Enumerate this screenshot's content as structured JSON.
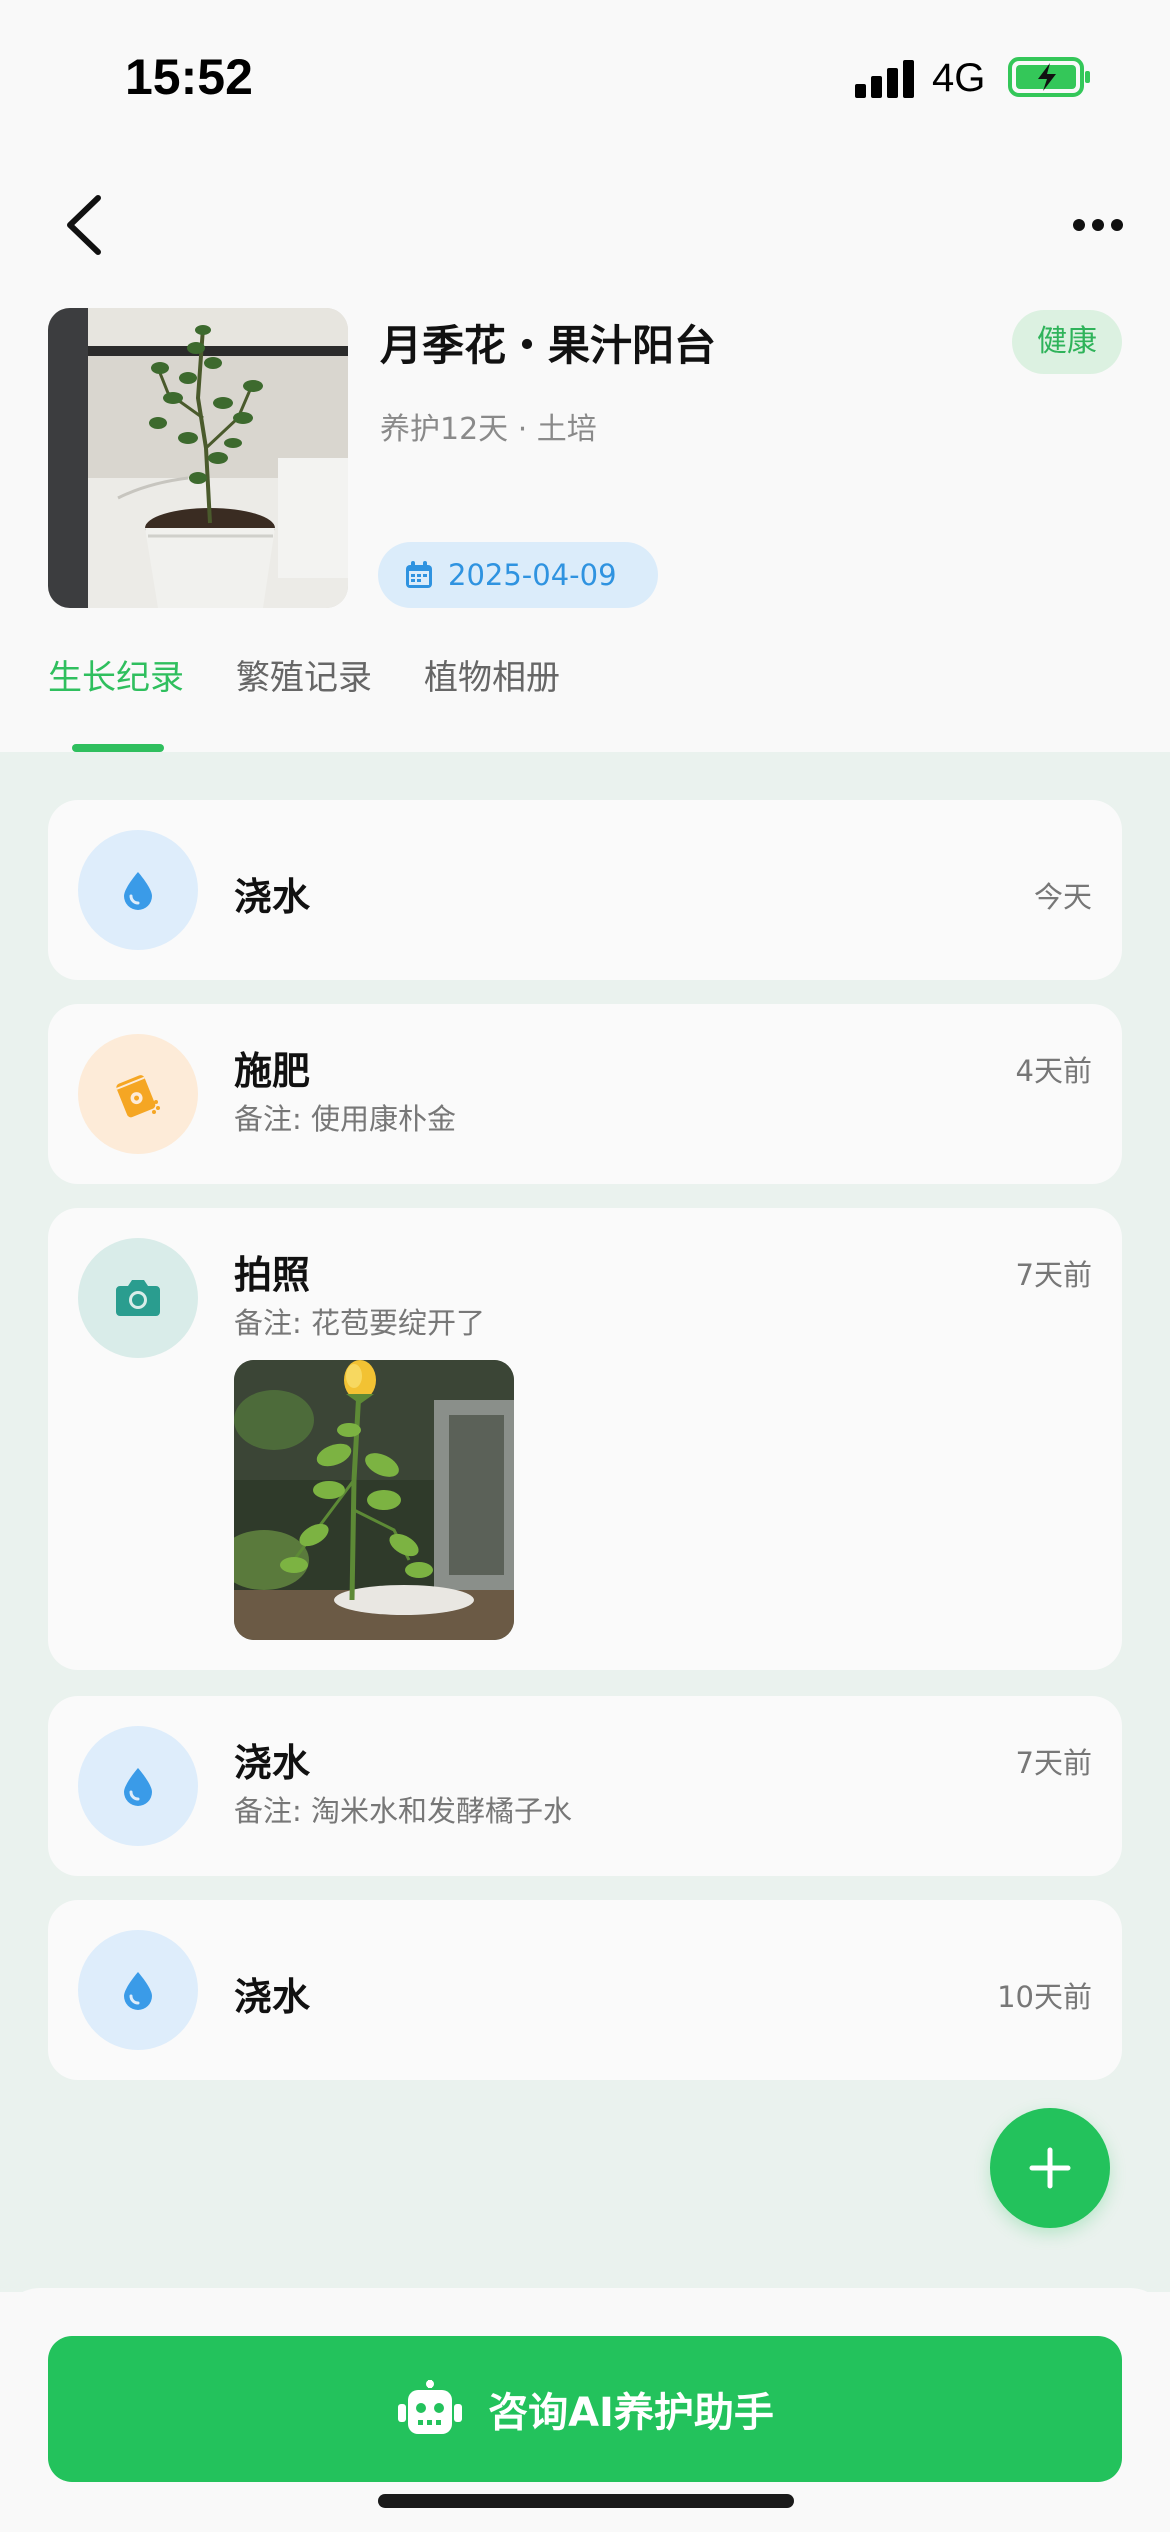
{
  "status_bar": {
    "time": "15:52",
    "network": "4G",
    "battery_color": "#34c759"
  },
  "header": {
    "back_icon": "chevron-left-icon",
    "more_icon": "more-horizontal-icon"
  },
  "plant": {
    "title": "月季花・果汁阳台",
    "health": "健康",
    "meta": "养护12天 · 土培",
    "date": "2025-04-09",
    "date_icon": "calendar-icon"
  },
  "tabs": [
    {
      "label": "生长纪录",
      "active": true
    },
    {
      "label": "繁殖记录",
      "active": false
    },
    {
      "label": "植物相册",
      "active": false
    }
  ],
  "records": [
    {
      "type": "浇水",
      "icon": "water-drop-icon",
      "note": "",
      "time": "今天"
    },
    {
      "type": "施肥",
      "icon": "fertilizer-icon",
      "note": "备注: 使用康朴金",
      "time": "4天前"
    },
    {
      "type": "拍照",
      "icon": "camera-icon",
      "note": "备注: 花苞要绽开了",
      "time": "7天前"
    },
    {
      "type": "浇水",
      "icon": "water-drop-icon",
      "note": "备注: 淘米水和发酵橘子水",
      "time": "7天前"
    },
    {
      "type": "浇水",
      "icon": "water-drop-icon",
      "note": "",
      "time": "10天前"
    }
  ],
  "fab": {
    "icon": "plus-icon"
  },
  "bottom": {
    "ai_button_label": "咨询AI养护助手",
    "ai_icon": "robot-icon"
  },
  "colors": {
    "accent": "#23c25c",
    "tab_active": "#2fbf5e",
    "content_bg": "#eaf2ee",
    "date_chip_text": "#2f93e0",
    "water_icon": "#3a9be8",
    "fertilizer_icon": "#f5a623",
    "camera_icon": "#2a9d8f"
  }
}
